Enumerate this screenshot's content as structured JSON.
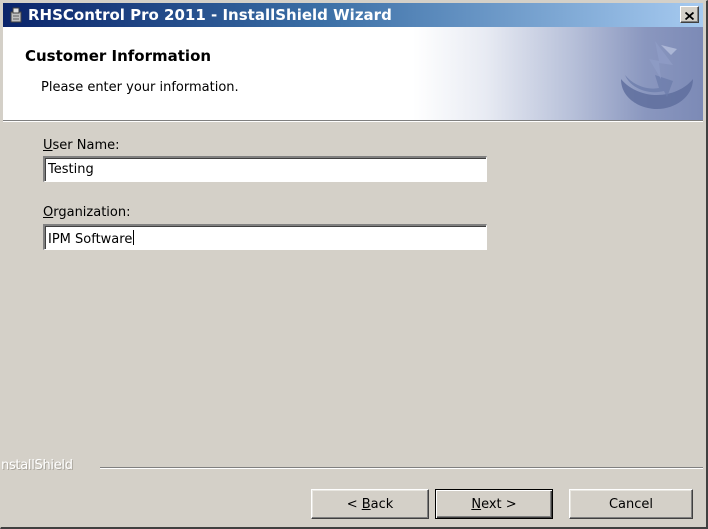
{
  "window": {
    "title": "RHSControl Pro 2011 - InstallShield Wizard",
    "close_label": "×"
  },
  "banner": {
    "title": "Customer Information",
    "subtitle": "Please enter your information."
  },
  "form": {
    "user_name": {
      "label_mnemonic": "U",
      "label_rest": "ser Name:",
      "value": "Testing"
    },
    "organization": {
      "label_mnemonic": "O",
      "label_rest": "rganization:",
      "value": "IPM Software"
    }
  },
  "footer": {
    "brand": "nstallShield"
  },
  "buttons": {
    "back": {
      "prefix": "< ",
      "mnemonic": "B",
      "rest": "ack"
    },
    "next": {
      "mnemonic": "N",
      "rest": "ext >"
    },
    "cancel": {
      "label": "Cancel"
    }
  },
  "colors": {
    "titlebar_start": "#0a246a",
    "titlebar_end": "#a6caf0",
    "dialog_face": "#d4d0c8",
    "banner_background": "#ffffff"
  },
  "icons": {
    "title_icon": "installer-box-icon",
    "banner_logo": "installshield-logo-icon",
    "close": "close-icon"
  }
}
